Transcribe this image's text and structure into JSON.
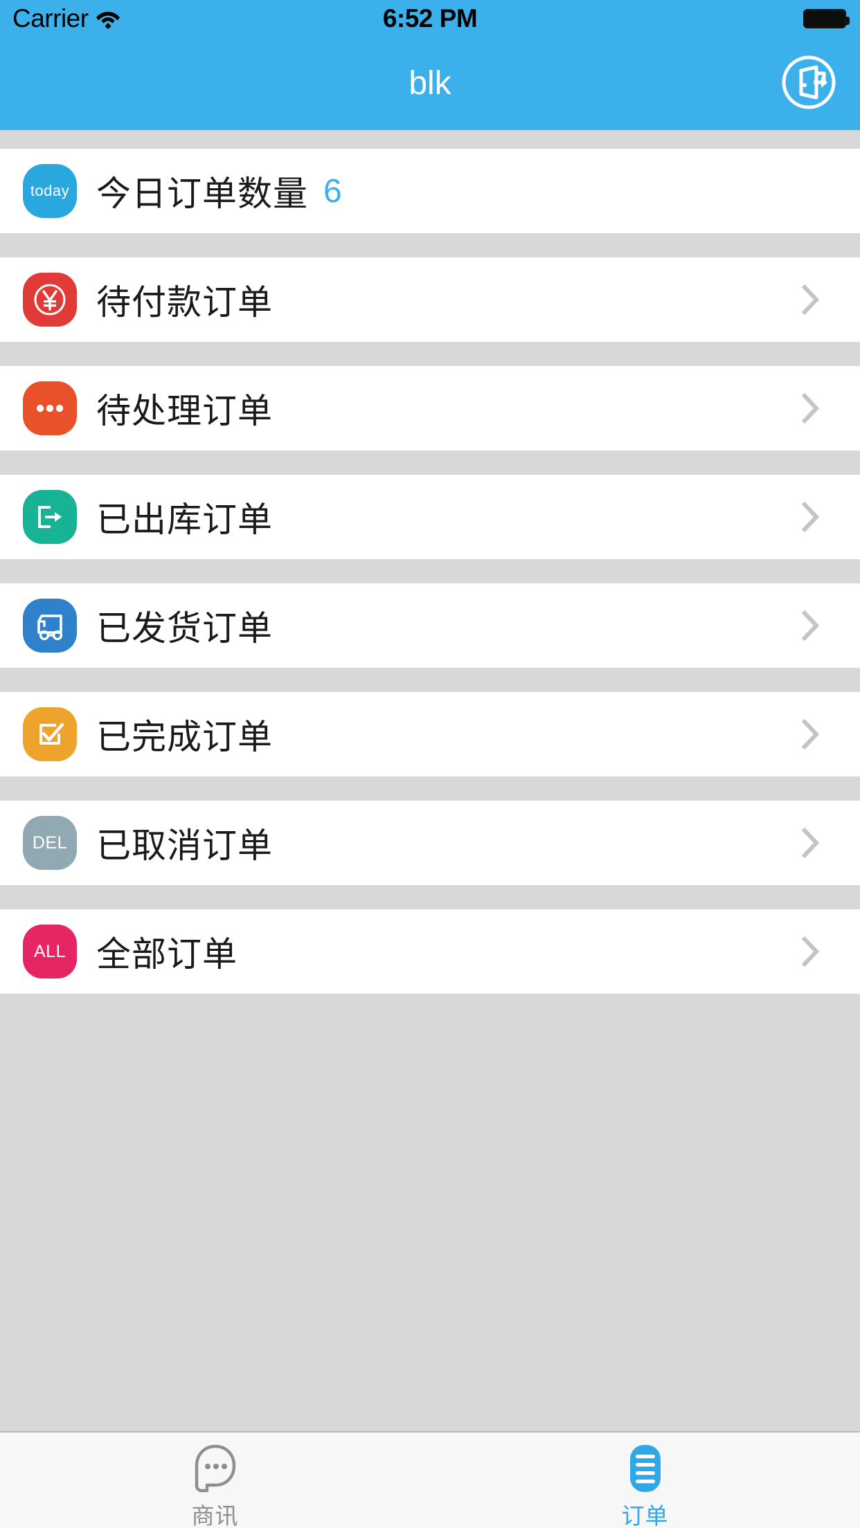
{
  "status_bar": {
    "carrier": "Carrier",
    "wifi_icon": "wifi-icon",
    "time": "6:52 PM",
    "battery_icon": "battery-full-icon"
  },
  "nav_bar": {
    "title": "blk",
    "background_color": "#3cb0ea",
    "title_color": "#ffffff",
    "logout_icon": "logout-door-arrow-icon"
  },
  "list": {
    "rows": [
      {
        "id": "today-order-count",
        "icon_name": "today-badge-icon",
        "icon_text": "today",
        "icon_color": "#29a8e0",
        "label": "今日订单数量",
        "count": "6",
        "count_color": "#3cb0ea",
        "has_chevron": false
      },
      {
        "id": "pending-payment-orders",
        "icon_name": "yuan-currency-icon",
        "icon_text": "¥",
        "icon_color": "#e03b37",
        "label": "待付款订单",
        "count": "",
        "has_chevron": true
      },
      {
        "id": "pending-processing-orders",
        "icon_name": "ellipsis-icon",
        "icon_text": "",
        "icon_color": "#e8512a",
        "label": "待处理订单",
        "count": "",
        "has_chevron": true
      },
      {
        "id": "shipped-out-orders",
        "icon_name": "export-box-arrow-icon",
        "icon_text": "",
        "icon_color": "#18b394",
        "label": "已出库订单",
        "count": "",
        "has_chevron": true
      },
      {
        "id": "delivered-orders",
        "icon_name": "truck-icon",
        "icon_text": "",
        "icon_color": "#2f81cc",
        "label": "已发货订单",
        "count": "",
        "has_chevron": true
      },
      {
        "id": "completed-orders",
        "icon_name": "checkbox-check-icon",
        "icon_text": "",
        "icon_color": "#eda32c",
        "label": "已完成订单",
        "count": "",
        "has_chevron": true
      },
      {
        "id": "cancelled-orders",
        "icon_name": "del-badge-icon",
        "icon_text": "DEL",
        "icon_color": "#91a9b2",
        "label": "已取消订单",
        "count": "",
        "has_chevron": true
      },
      {
        "id": "all-orders",
        "icon_name": "all-badge-icon",
        "icon_text": "ALL",
        "icon_color": "#e52663",
        "label": "全部订单",
        "count": "",
        "has_chevron": true
      }
    ]
  },
  "tab_bar": {
    "items": [
      {
        "id": "tab-business-news",
        "label": "商讯",
        "icon_name": "chat-bubble-ellipsis-icon",
        "active": false,
        "color": "#8e8e8e"
      },
      {
        "id": "tab-orders",
        "label": "订单",
        "icon_name": "order-list-icon",
        "active": true,
        "color": "#2fa8e8"
      }
    ]
  }
}
